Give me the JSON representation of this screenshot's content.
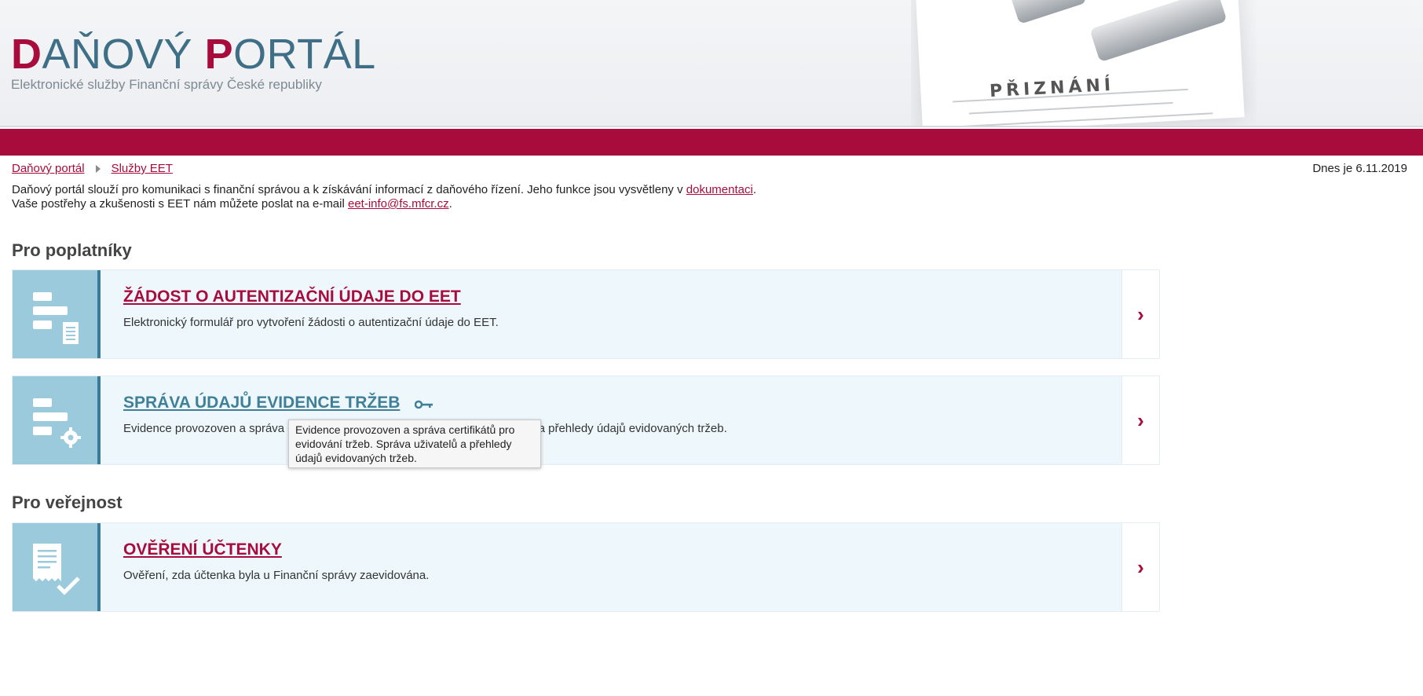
{
  "header": {
    "logo_part1_cap": "D",
    "logo_part1_rest": "AŇOVÝ ",
    "logo_part2_cap": "P",
    "logo_part2_rest": "ORTÁL",
    "subtitle": "Elektronické služby Finanční správy České republiky",
    "art_title": "PŘIZNÁNÍ"
  },
  "breadcrumb": {
    "items": [
      {
        "label": "Daňový portál"
      },
      {
        "label": "Služby EET"
      }
    ]
  },
  "date_text": "Dnes je 6.11.2019",
  "intro": {
    "line1_text": "Daňový portál slouží pro komunikaci s finanční správou a k získávání informací z daňového řízení. Jeho funkce jsou vysvětleny v ",
    "line1_link": "dokumentaci",
    "line1_end": ".",
    "line2_text": "Vaše postřehy a zkušenosti s EET nám můžete poslat na e-mail ",
    "line2_link": "eet-info@fs.mfcr.cz",
    "line2_end": "."
  },
  "sections": [
    {
      "title": "Pro poplatníky"
    },
    {
      "title": "Pro veřejnost"
    }
  ],
  "cards": [
    {
      "title": "ŽÁDOST O AUTENTIZAČNÍ ÚDAJE DO EET",
      "description": "Elektronický formulář pro vytvoření žádosti o autentizační údaje do EET.",
      "icon": "form-document-icon"
    },
    {
      "title": "SPRÁVA ÚDAJŮ EVIDENCE TRŽEB",
      "description": "Evidence provozoven a správa certifikátů pro evidování tržeb. Správa uživatelů a přehledy údajů evidovaných tržeb.",
      "icon": "form-gear-icon"
    },
    {
      "title": "OVĚŘENÍ ÚČTENKY",
      "description": "Ověření, zda účtenka byla u Finanční správy zaevidována.",
      "icon": "receipt-check-icon"
    }
  ],
  "tooltip": {
    "text": "Evidence provozoven a správa certifikátů pro evidování tržeb. Správa uživatelů a přehledy údajů evidovaných tržeb."
  },
  "arrow_glyph": "›",
  "colors": {
    "brand_red": "#a80c3c",
    "brand_blue": "#3f6f86",
    "card_bg": "#eef8fc",
    "icon_bg": "#9ccadd"
  }
}
